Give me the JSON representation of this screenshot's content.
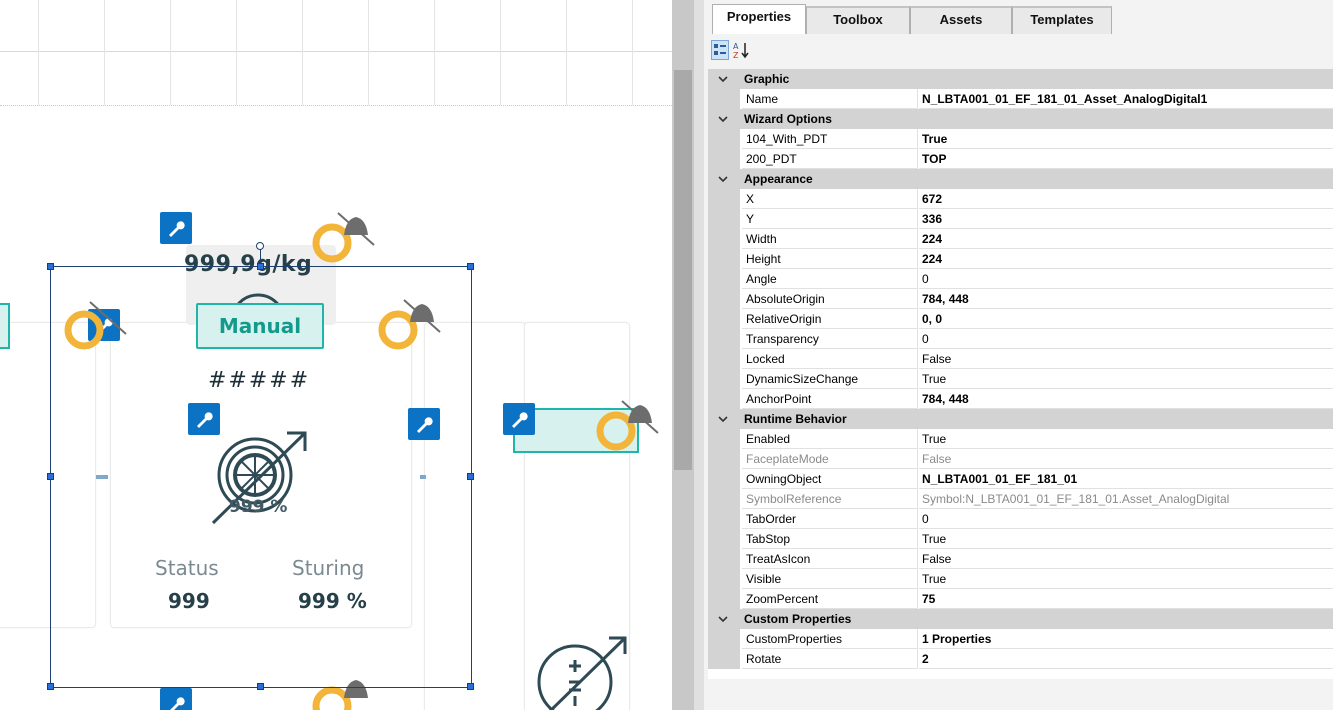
{
  "canvas": {
    "value_label": "999,9g/kg",
    "manual_label": "Manual",
    "hash_label": "#####",
    "percent_overlay": "999 %",
    "status_label": "Status",
    "status_value": "999",
    "sturing_label": "Sturing",
    "sturing_value": "999 %"
  },
  "panel": {
    "tabs": [
      {
        "label": "Properties",
        "active": true
      },
      {
        "label": "Toolbox",
        "active": false
      },
      {
        "label": "Assets",
        "active": false
      },
      {
        "label": "Templates",
        "active": false
      }
    ],
    "toolbar": {
      "categorized_icon": "categorized-view-icon",
      "alpha_icon": "sort-alphabetical-icon",
      "alpha_glyph_a": "A",
      "alpha_glyph_z": "Z"
    },
    "sections": [
      {
        "title": "Graphic",
        "rows": [
          {
            "name": "Name",
            "value": "N_LBTA001_01_EF_181_01_Asset_AnalogDigital1",
            "bold": true
          }
        ]
      },
      {
        "title": "Wizard Options",
        "rows": [
          {
            "name": "104_With_PDT",
            "value": "True",
            "bold": true
          },
          {
            "name": "200_PDT",
            "value": "TOP",
            "bold": true
          }
        ]
      },
      {
        "title": "Appearance",
        "rows": [
          {
            "name": "X",
            "value": "672",
            "bold": true
          },
          {
            "name": "Y",
            "value": "336",
            "bold": true
          },
          {
            "name": "Width",
            "value": "224",
            "bold": true
          },
          {
            "name": "Height",
            "value": "224",
            "bold": true
          },
          {
            "name": "Angle",
            "value": "0"
          },
          {
            "name": "AbsoluteOrigin",
            "value": "784, 448",
            "bold": true
          },
          {
            "name": "RelativeOrigin",
            "value": "0, 0",
            "bold": true
          },
          {
            "name": "Transparency",
            "value": "0"
          },
          {
            "name": "Locked",
            "value": "False"
          },
          {
            "name": "DynamicSizeChange",
            "value": "True"
          },
          {
            "name": "AnchorPoint",
            "value": "784, 448",
            "bold": true
          }
        ]
      },
      {
        "title": "Runtime Behavior",
        "rows": [
          {
            "name": "Enabled",
            "value": "True"
          },
          {
            "name": "FaceplateMode",
            "value": "False",
            "dim": true
          },
          {
            "name": "OwningObject",
            "value": "N_LBTA001_01_EF_181_01",
            "bold": true
          },
          {
            "name": "SymbolReference",
            "value": "Symbol:N_LBTA001_01_EF_181_01.Asset_AnalogDigital",
            "dim": true
          },
          {
            "name": "TabOrder",
            "value": "0"
          },
          {
            "name": "TabStop",
            "value": "True"
          },
          {
            "name": "TreatAsIcon",
            "value": "False"
          },
          {
            "name": "Visible",
            "value": "True"
          },
          {
            "name": "ZoomPercent",
            "value": "75",
            "bold": true
          }
        ]
      },
      {
        "title": "Custom Properties",
        "rows": [
          {
            "name": "CustomProperties",
            "value": "1 Properties",
            "bold": true
          },
          {
            "name": "Rotate",
            "value": "2",
            "bold": true
          }
        ]
      }
    ]
  },
  "colors": {
    "wrench_blue": "#0b72c4",
    "ring_orange": "#f2b53a",
    "teal": "#1fb5a8",
    "dark_slate": "#26404a",
    "category_gray": "#d3d3d3"
  }
}
